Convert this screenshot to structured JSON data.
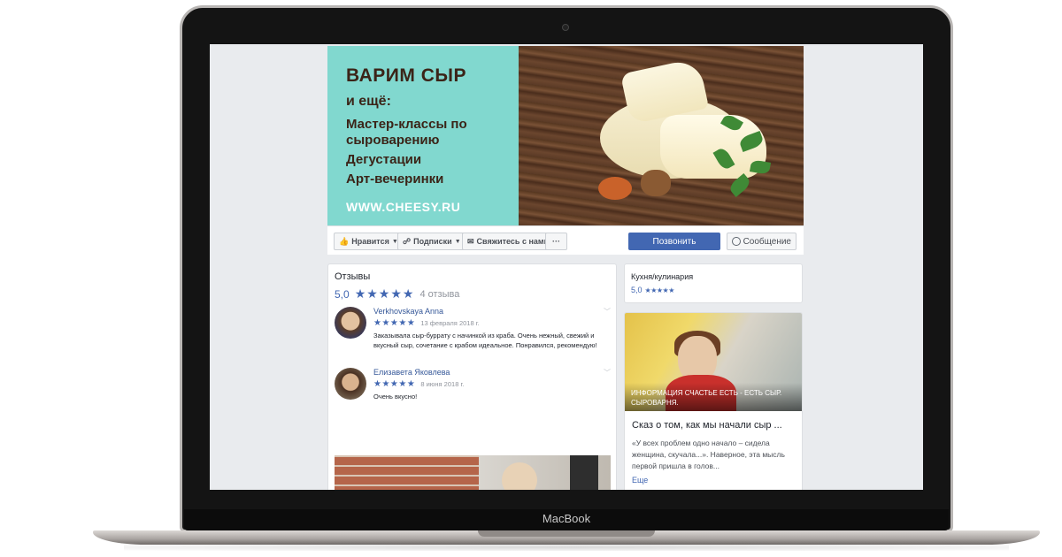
{
  "device": {
    "brand": "MacBook"
  },
  "cover": {
    "title": "ВАРИМ СЫР",
    "subtitle": "и ещё:",
    "lines": [
      "Мастер-классы по сыроварению",
      "Дегустации",
      "Арт-вечеринки"
    ],
    "url": "WWW.CHEESY.RU"
  },
  "actions": {
    "like": "Нравится",
    "follow": "Подписки",
    "contact": "Свяжитесь с нами",
    "more": "···",
    "call": "Позвонить",
    "message": "Сообщение"
  },
  "reviews": {
    "title": "Отзывы",
    "rating": "5,0",
    "stars": "★★★★★",
    "count": "4 отзыва",
    "items": [
      {
        "name": "Verkhovskaya Anna",
        "stars": "★★★★★",
        "date": "13 февраля 2018 г.",
        "text": "Заказывала сыр-буррату с начинкой из краба. Очень нежный, свежий и вкусный сыр, сочетание с крабом идеальное. Понравился, рекомендую!"
      },
      {
        "name": "Елизавета Яковлева",
        "stars": "★★★★★",
        "date": "8 июня 2018 г.",
        "text": "Очень вкусно!"
      }
    ]
  },
  "category": {
    "name": "Кухня/кулинария",
    "rating": "5,0",
    "stars": "★★★★★"
  },
  "note": {
    "overlay": "ИНФОРМАЦИЯ СЧАСТЬЕ ЕСТЬ - ЕСТЬ СЫР. СЫРОВАРНЯ.",
    "title": "Сказ о том, как мы начали сыр ...",
    "excerpt": "«У всех проблем одно начало – сидела женщина, скучала...». Наверное, эта мысль первой пришла в голов...",
    "more": "Еще"
  }
}
